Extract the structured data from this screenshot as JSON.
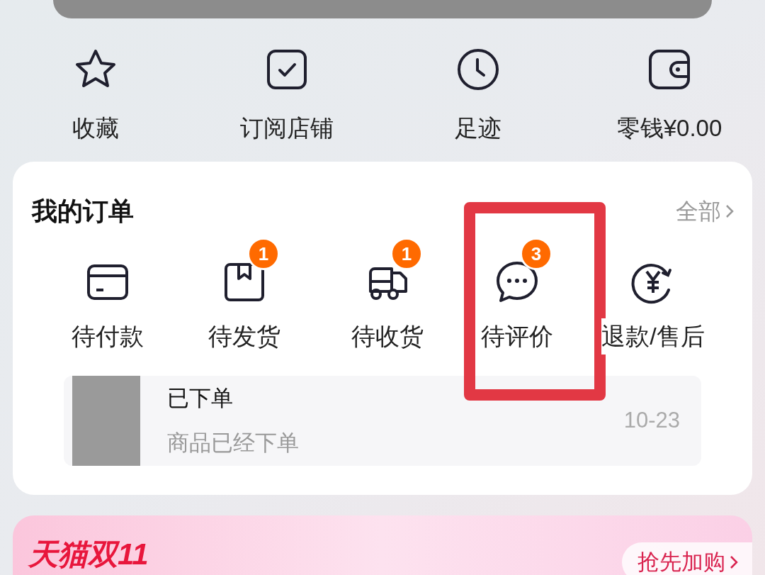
{
  "shortcuts": [
    {
      "label": "收藏"
    },
    {
      "label": "订阅店铺"
    },
    {
      "label": "足迹"
    },
    {
      "label": "零钱¥0.00"
    }
  ],
  "orders": {
    "title": "我的订单",
    "all_link": "全部",
    "tabs": [
      {
        "label": "待付款",
        "highlighted": false
      },
      {
        "label": "待发货",
        "badge": "1",
        "highlighted": false
      },
      {
        "label": "待收货",
        "badge": "1",
        "highlighted": false
      },
      {
        "label": "待评价",
        "badge": "3",
        "highlighted": true
      },
      {
        "label": "退款/售后",
        "highlighted": false
      }
    ],
    "recent": {
      "status": "已下单",
      "detail": "商品已经下单",
      "date": "10-23"
    }
  },
  "banner": {
    "title": "天猫双11",
    "button": "抢先加购"
  }
}
